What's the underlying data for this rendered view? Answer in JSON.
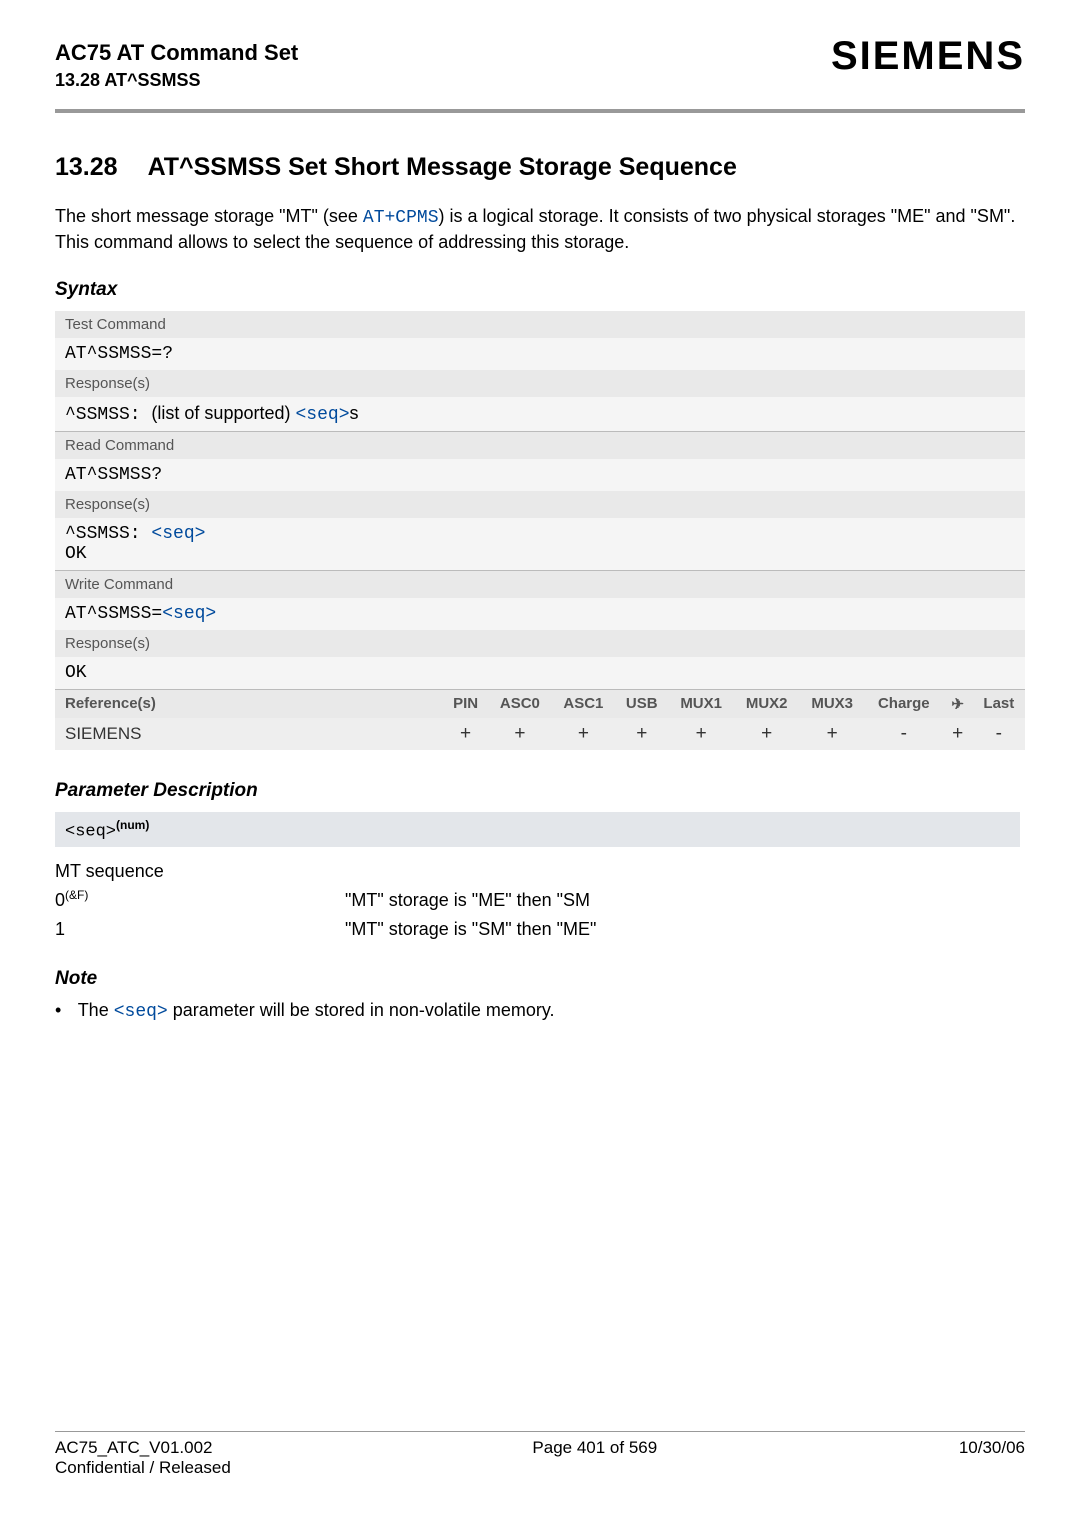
{
  "header": {
    "doc_title": "AC75 AT Command Set",
    "doc_subtitle": "13.28 AT^SSMSS",
    "logo": "SIEMENS"
  },
  "section": {
    "number": "13.28",
    "title": "AT^SSMSS   Set Short Message Storage Sequence"
  },
  "intro": {
    "part1": "The short message storage \"MT\" (see ",
    "link": "AT+CPMS",
    "part2": ") is a logical storage. It consists of two physical storages \"ME\" and \"SM\". This command allows to select the sequence of addressing this storage."
  },
  "syntax_heading": "Syntax",
  "syntax": {
    "test_label": "Test Command",
    "test_cmd": "AT^SSMSS=?",
    "test_resp_label": "Response(s)",
    "test_resp_prefix": "^SSMSS: ",
    "test_resp_text": "(list of supported) ",
    "test_resp_param": "<seq>",
    "test_resp_suffix": "s",
    "read_label": "Read Command",
    "read_cmd": "AT^SSMSS?",
    "read_resp_label": "Response(s)",
    "read_resp_prefix": "^SSMSS: ",
    "read_resp_param": "<seq>",
    "read_ok": "OK",
    "write_label": "Write Command",
    "write_cmd_prefix": "AT^SSMSS=",
    "write_cmd_param": "<seq>",
    "write_resp_label": "Response(s)",
    "write_ok": "OK"
  },
  "ref_table": {
    "ref_label": "Reference(s)",
    "cols": [
      "PIN",
      "ASC0",
      "ASC1",
      "USB",
      "MUX1",
      "MUX2",
      "MUX3",
      "Charge",
      "",
      "Last"
    ],
    "ref_name": "SIEMENS",
    "vals": [
      "+",
      "+",
      "+",
      "+",
      "+",
      "+",
      "+",
      "-",
      "+",
      "-"
    ]
  },
  "param_heading": "Parameter Description",
  "param": {
    "tag_text": "<seq>",
    "tag_sup": "(num)",
    "desc_title": "MT sequence",
    "row0_key_base": "0",
    "row0_key_sup": "(&F)",
    "row0_val": "\"MT\" storage is \"ME\" then \"SM",
    "row1_key": "1",
    "row1_val": "\"MT\" storage is \"SM\" then \"ME\""
  },
  "note_heading": "Note",
  "note": {
    "text1": "The ",
    "param": "<seq>",
    "text2": " parameter will be stored in non-volatile memory."
  },
  "footer": {
    "left": "AC75_ATC_V01.002",
    "left2": "Confidential / Released",
    "center": "Page 401 of 569",
    "right": "10/30/06"
  }
}
